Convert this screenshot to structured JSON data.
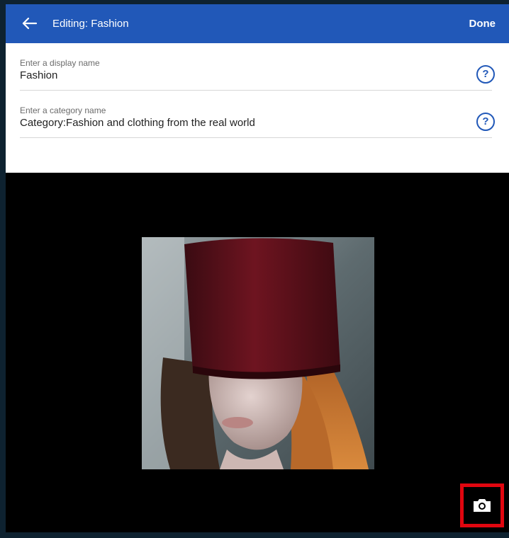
{
  "header": {
    "title": "Editing: Fashion",
    "done_label": "Done",
    "back_icon": "arrow-left-icon"
  },
  "fields": [
    {
      "label": "Enter a display name",
      "value": "Fashion",
      "help_label": "?"
    },
    {
      "label": "Enter a category name",
      "value": "Category:Fashion and clothing from the real world",
      "help_label": "?"
    }
  ],
  "image": {
    "camera_icon": "camera-icon"
  },
  "colors": {
    "header_bg": "#2158b8",
    "accent": "#2158b8",
    "highlight_border": "#e1060f",
    "image_bg": "#000000"
  }
}
